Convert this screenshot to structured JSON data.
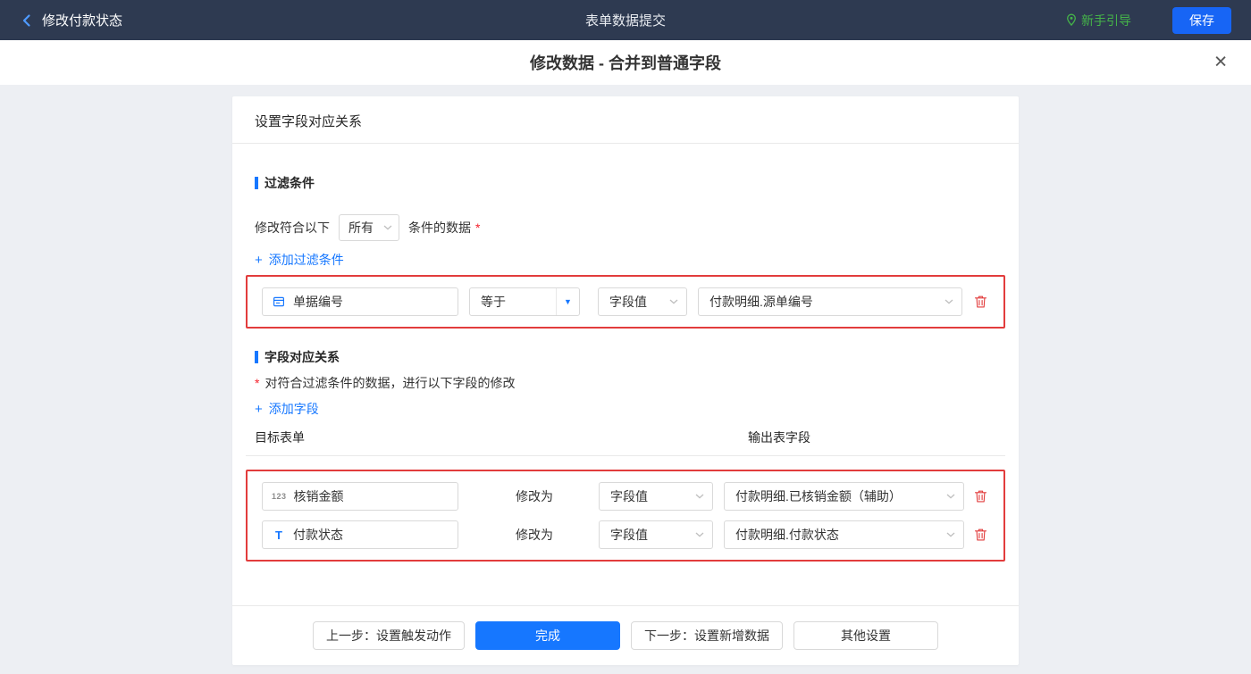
{
  "colors": {
    "accent": "#1677ff",
    "danger": "#e23c3c",
    "success": "#45b449",
    "topbar_bg": "#2e3a51",
    "save_button": "#1765f5"
  },
  "icons": {
    "close": "✕",
    "operator_arrow": "▼",
    "add_plus": "+"
  },
  "topbar": {
    "back_label": "修改付款状态",
    "title": "表单数据提交",
    "guide_label": "新手引导",
    "save_label": "保存"
  },
  "modal": {
    "title": "修改数据 - 合并到普通字段"
  },
  "panel": {
    "header": "设置字段对应关系",
    "filter": {
      "section_title": "过滤条件",
      "prefix_label": "修改符合以下",
      "match_value": "所有",
      "suffix_label": "条件的数据",
      "required_mark": "*",
      "add_label": "添加过滤条件",
      "rows": [
        {
          "field": "单据编号",
          "operator": "等于",
          "value_type": "字段值",
          "value": "付款明细.源单编号"
        }
      ]
    },
    "mapping": {
      "section_title": "字段对应关系",
      "required_mark": "*",
      "description": "对符合过滤条件的数据，进行以下字段的修改",
      "add_label": "添加字段",
      "col_target": "目标表单",
      "col_output": "输出表字段",
      "modify_label": "修改为",
      "rows": [
        {
          "icon": "123",
          "field": "核销金额",
          "value_type": "字段值",
          "value": "付款明细.已核销金额（辅助）"
        },
        {
          "icon": "T",
          "field": "付款状态",
          "value_type": "字段值",
          "value": "付款明细.付款状态"
        }
      ]
    },
    "footer": {
      "prev_label": "上一步：设置触发动作",
      "done_label": "完成",
      "next_label": "下一步：设置新增数据",
      "other_label": "其他设置"
    }
  }
}
